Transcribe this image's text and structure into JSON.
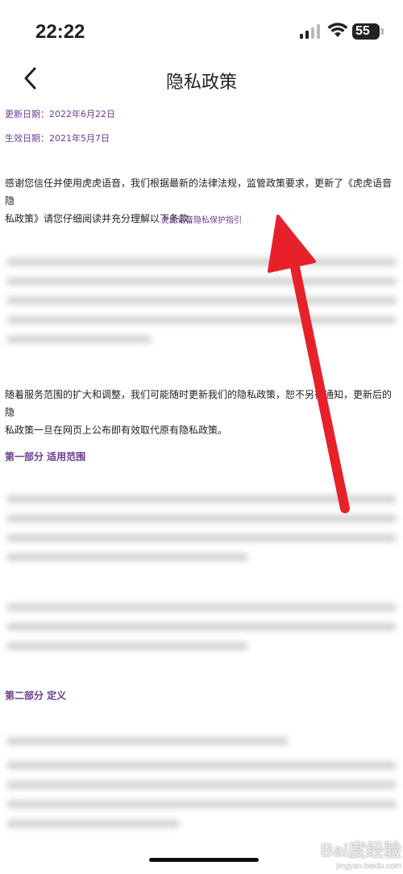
{
  "status_bar": {
    "time": "22:22",
    "battery": "55"
  },
  "nav": {
    "title": "隐私政策"
  },
  "content": {
    "updated_date": "更新日期：2022年6月22日",
    "effective_date": "生效日期：2021年5月7日",
    "intro_line1": "感谢您信任并使用虎虎语音，我们根据最新的法律法规，监管政策要求，更新了《虎虎语音隐",
    "intro_line2": "私政策》请您仔细阅读并充分理解以下条款。",
    "guide_link": "虎虎语音隐私保护指引",
    "notice_line1": "随着服务范围的扩大和调整，我们可能随时更新我们的隐私政策，恕不另行通知，更新后的隐",
    "notice_line2": "私政策一旦在网页上公布即有效取代原有隐私政策。",
    "section1": "第一部分 适用范围",
    "section2": "第二部分  定义"
  },
  "watermark": {
    "logo": "Bai度经验",
    "sub": "jingyan.baidu.com"
  },
  "colors": {
    "accent": "#6a3d8f",
    "arrow": "#e8202a"
  }
}
